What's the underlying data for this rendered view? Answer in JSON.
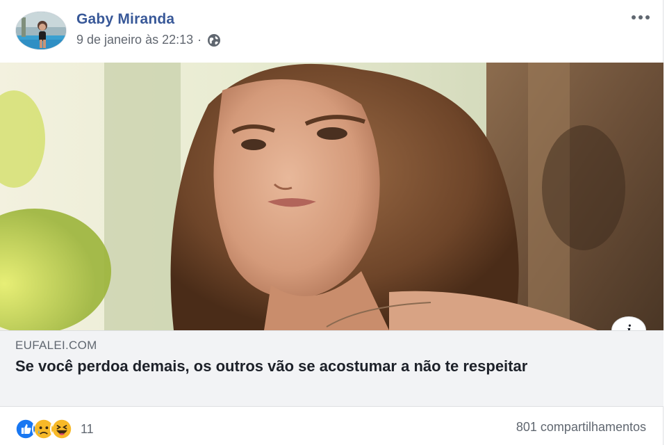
{
  "post": {
    "author": "Gaby Miranda",
    "timestamp": "9 de janeiro às 22:13",
    "separator": "·",
    "privacy_icon": "globe-icon",
    "more_icon": "more-options-icon"
  },
  "link_preview": {
    "domain": "EUFALEI.COM",
    "title": "Se você perdoa demais, os outros vão se acostumar a não te respeitar",
    "info_label": "i"
  },
  "footer": {
    "reactions": [
      "like-reaction-icon",
      "sad-reaction-icon",
      "haha-reaction-icon"
    ],
    "reaction_count": "11",
    "shares": "801 compartilhamentos"
  },
  "colors": {
    "author_link": "#385898",
    "secondary_text": "#606770",
    "caption_background": "#f2f3f5",
    "like_blue": "#1877f2",
    "reaction_yellow": "#f7b928"
  }
}
